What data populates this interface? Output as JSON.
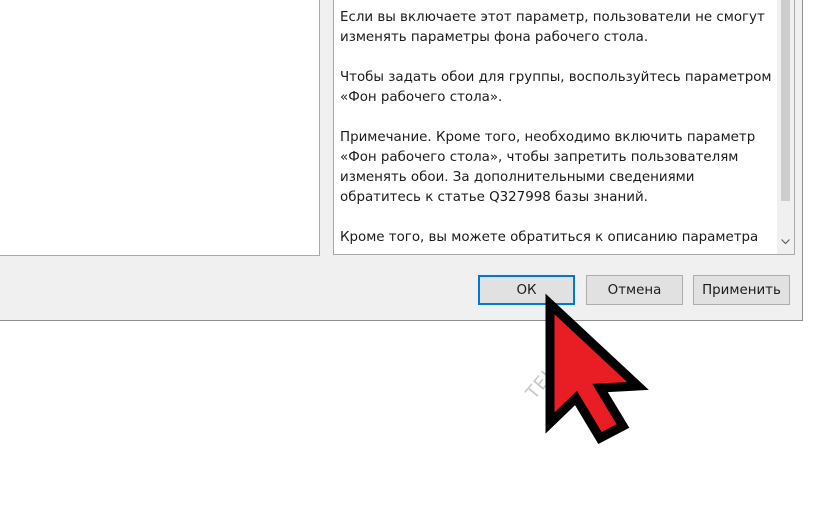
{
  "help": {
    "paragraphs": [
      "Если вы включаете этот параметр, пользователи не смогут изменять параметры фона рабочего стола.",
      "Чтобы задать обои для группы, воспользуйтесь параметром «Фон рабочего стола».",
      "Примечание. Кроме того, необходимо включить параметр «Фон рабочего стола», чтобы запретить пользователям изменять обои. За дополнительными сведениями обратитесь к статье Q327998 базы знаний.",
      "Кроме того, вы можете обратиться к описанию параметра"
    ]
  },
  "buttons": {
    "ok": "ОК",
    "cancel": "Отмена",
    "apply": "Применить"
  },
  "watermark": "TEHDA",
  "icons": {
    "scroll_down": "chevron-down-icon",
    "cursor": "arrow-cursor-icon"
  },
  "colors": {
    "cursor_fill": "#e81e24",
    "ok_focus_border": "#0078d7"
  }
}
